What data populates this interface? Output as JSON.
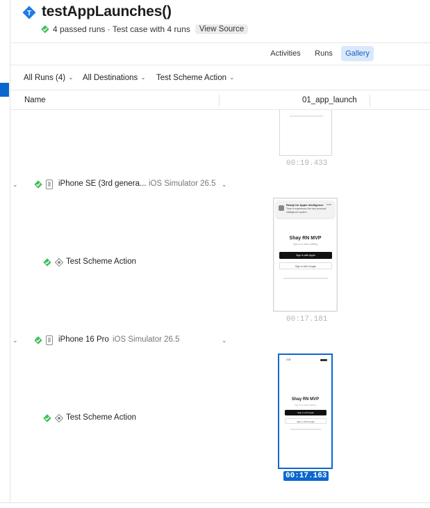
{
  "header": {
    "title": "testAppLaunches()",
    "subtitle": "4 passed runs · Test case with 4 runs",
    "view_source_label": "View Source"
  },
  "tabs": [
    {
      "label": "Activities",
      "selected": false
    },
    {
      "label": "Runs",
      "selected": false
    },
    {
      "label": "Gallery",
      "selected": true
    }
  ],
  "filters": {
    "runs": "All Runs (4)",
    "destinations": "All Destinations",
    "scheme": "Test Scheme Action"
  },
  "columns": {
    "name": "Name",
    "attachment": "01_app_launch"
  },
  "gallery": {
    "first_timestamp": "00:19.433",
    "destinations": [
      {
        "name": "iPhone SE (3rd genera...",
        "platform": "iOS Simulator 26.5",
        "scheme": "Test Scheme Action",
        "timestamp": "00:17.181",
        "screenshot": {
          "notification_title": "Ready for Apple Intelligence",
          "notification_line1": "Time to experience the new personal",
          "notification_line2": "intelligence system.",
          "notification_more": "now",
          "app_title": "Shay RN MVP",
          "app_subtitle": "Sign in to start chatting",
          "apple_button": "Sign in with Apple",
          "google_button": "Sign in with Google"
        }
      },
      {
        "name": "iPhone 16 Pro",
        "platform": "iOS Simulator 26.5",
        "scheme": "Test Scheme Action",
        "timestamp": "00:17.163",
        "selected": true,
        "screenshot": {
          "status_time": "2:31",
          "app_title": "Shay RN MVP",
          "app_subtitle": "Sign in to start chatting",
          "apple_button": "Sign in with Apple",
          "google_button": "Sign in with Google"
        }
      }
    ]
  },
  "colors": {
    "accent": "#0a67d0",
    "success": "#3fbf5a",
    "gallery_tab_bg": "#d9e8fb"
  }
}
